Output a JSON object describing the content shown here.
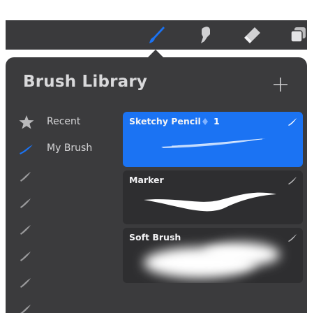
{
  "toolbar": {
    "tools": [
      {
        "name": "brush",
        "active": true
      },
      {
        "name": "smudge",
        "active": false
      },
      {
        "name": "eraser",
        "active": false
      },
      {
        "name": "layers",
        "active": false
      }
    ],
    "active_color": "#1b73f3"
  },
  "library": {
    "title": "Brush Library",
    "add_icon": "plus-icon"
  },
  "sets": [
    {
      "label": "Recent",
      "icon": "star-icon"
    },
    {
      "label": "My Brush",
      "icon": "brush-stroke-icon",
      "active": true
    },
    {
      "label": "",
      "icon": "brush-stroke-icon"
    },
    {
      "label": "",
      "icon": "brush-stroke-icon"
    },
    {
      "label": "",
      "icon": "brush-stroke-icon"
    },
    {
      "label": "",
      "icon": "brush-stroke-icon"
    },
    {
      "label": "",
      "icon": "brush-stroke-icon"
    },
    {
      "label": "",
      "icon": "brush-stroke-icon"
    }
  ],
  "brushes": [
    {
      "name": "Sketchy Pencil",
      "badge": "1",
      "selected": true
    },
    {
      "name": "Marker",
      "badge": "",
      "selected": false
    },
    {
      "name": "Soft Brush",
      "badge": "",
      "selected": false
    }
  ],
  "colors": {
    "panel": "#3b3b3d",
    "toolbar": "#3a3a3c",
    "selected_card": "#1b73f3",
    "card": "#2e2e30"
  }
}
